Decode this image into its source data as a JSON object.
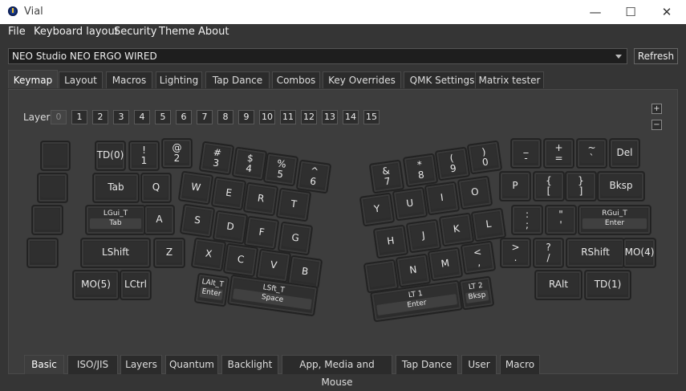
{
  "window": {
    "title": "Vial"
  },
  "menu": [
    "File",
    "Keyboard layout",
    "Security",
    "Theme",
    "About"
  ],
  "device": {
    "selected": "NEO Studio NEO ERGO WIRED",
    "refresh_label": "Refresh"
  },
  "tabs": [
    "Keymap",
    "Layout",
    "Macros",
    "Lighting",
    "Tap Dance",
    "Combos",
    "Key Overrides",
    "QMK Settings",
    "Matrix tester"
  ],
  "active_tab": "Keymap",
  "layers": {
    "label": "Layer",
    "items": [
      "0",
      "1",
      "2",
      "3",
      "4",
      "5",
      "6",
      "7",
      "8",
      "9",
      "10",
      "11",
      "12",
      "13",
      "14",
      "15"
    ],
    "active": "0"
  },
  "zoom": {
    "plus": "+",
    "minus": "−"
  },
  "keys": [
    {
      "id": "k-l0-0",
      "label": ""
    },
    {
      "id": "k-l0-1",
      "label": "TD(0)"
    },
    {
      "id": "k-l0-2",
      "label": "!\n1"
    },
    {
      "id": "k-l0-3",
      "label": "@\n2"
    },
    {
      "id": "k-l0-4",
      "label": "#\n3"
    },
    {
      "id": "k-l0-5",
      "label": "$\n4"
    },
    {
      "id": "k-l0-6",
      "label": "%\n5"
    },
    {
      "id": "k-l0-7",
      "label": "^\n6"
    },
    {
      "id": "k-l1-0",
      "label": ""
    },
    {
      "id": "k-l1-1",
      "label": "Tab"
    },
    {
      "id": "k-l1-2",
      "label": "Q"
    },
    {
      "id": "k-l1-3",
      "label": "W"
    },
    {
      "id": "k-l1-4",
      "label": "E"
    },
    {
      "id": "k-l1-5",
      "label": "R"
    },
    {
      "id": "k-l1-6",
      "label": "T"
    },
    {
      "id": "k-l2-0",
      "label": ""
    },
    {
      "id": "k-l2-1",
      "top": "LGui_T",
      "bot": "Tab"
    },
    {
      "id": "k-l2-2",
      "label": "A"
    },
    {
      "id": "k-l2-3",
      "label": "S"
    },
    {
      "id": "k-l2-4",
      "label": "D"
    },
    {
      "id": "k-l2-5",
      "label": "F"
    },
    {
      "id": "k-l2-6",
      "label": "G"
    },
    {
      "id": "k-l3-0",
      "label": ""
    },
    {
      "id": "k-l3-1",
      "label": "LShift"
    },
    {
      "id": "k-l3-2",
      "label": "Z"
    },
    {
      "id": "k-l3-3",
      "label": "X"
    },
    {
      "id": "k-l3-4",
      "label": "C"
    },
    {
      "id": "k-l3-5",
      "label": "V"
    },
    {
      "id": "k-l3-6",
      "label": "B"
    },
    {
      "id": "k-l4-0",
      "label": "MO(5)"
    },
    {
      "id": "k-l4-1",
      "label": "LCtrl"
    },
    {
      "id": "k-l4-2",
      "top": "LAlt_T",
      "bot": "Enter"
    },
    {
      "id": "k-l4-3",
      "top": "LSft_T",
      "bot": "Space"
    },
    {
      "id": "k-r0-0",
      "label": "&\n7"
    },
    {
      "id": "k-r0-1",
      "label": "*\n8"
    },
    {
      "id": "k-r0-2",
      "label": "(\n9"
    },
    {
      "id": "k-r0-3",
      "label": ")\n0"
    },
    {
      "id": "k-r0-4",
      "label": "_\n-"
    },
    {
      "id": "k-r0-5",
      "label": "+\n="
    },
    {
      "id": "k-r0-6",
      "label": "~\n`"
    },
    {
      "id": "k-r0-7",
      "label": "Del"
    },
    {
      "id": "k-r1-0",
      "label": "Y"
    },
    {
      "id": "k-r1-1",
      "label": "U"
    },
    {
      "id": "k-r1-2",
      "label": "I"
    },
    {
      "id": "k-r1-3",
      "label": "O"
    },
    {
      "id": "k-r1-4",
      "label": "P"
    },
    {
      "id": "k-r1-5",
      "label": "{\n["
    },
    {
      "id": "k-r1-6",
      "label": "}\n]"
    },
    {
      "id": "k-r1-7",
      "label": "Bksp"
    },
    {
      "id": "k-r2-0",
      "label": "H"
    },
    {
      "id": "k-r2-1",
      "label": "J"
    },
    {
      "id": "k-r2-2",
      "label": "K"
    },
    {
      "id": "k-r2-3",
      "label": "L"
    },
    {
      "id": "k-r2-4",
      "label": ":\n;"
    },
    {
      "id": "k-r2-5",
      "label": "\"\n'"
    },
    {
      "id": "k-r2-6",
      "top": "RGui_T",
      "bot": "Enter"
    },
    {
      "id": "k-r3-0",
      "label": ""
    },
    {
      "id": "k-r3-1",
      "label": "N"
    },
    {
      "id": "k-r3-2",
      "label": "M"
    },
    {
      "id": "k-r3-3",
      "label": "<\n,"
    },
    {
      "id": "k-r3-4",
      "label": ">\n."
    },
    {
      "id": "k-r3-5",
      "label": "?\n/"
    },
    {
      "id": "k-r3-6",
      "label": "RShift"
    },
    {
      "id": "k-r3-7",
      "label": "MO(4)"
    },
    {
      "id": "k-r4-0",
      "top": "LT 1",
      "bot": "Enter"
    },
    {
      "id": "k-r4-1",
      "top": "LT 2",
      "bot": "Bksp"
    },
    {
      "id": "k-r4-2",
      "label": "RAlt"
    },
    {
      "id": "k-r4-3",
      "label": "TD(1)"
    }
  ],
  "bottom_tabs": [
    "Basic",
    "ISO/JIS",
    "Layers",
    "Quantum",
    "Backlight",
    "App, Media and Mouse",
    "Tap Dance",
    "User",
    "Macro"
  ],
  "active_bottom_tab": "Basic"
}
